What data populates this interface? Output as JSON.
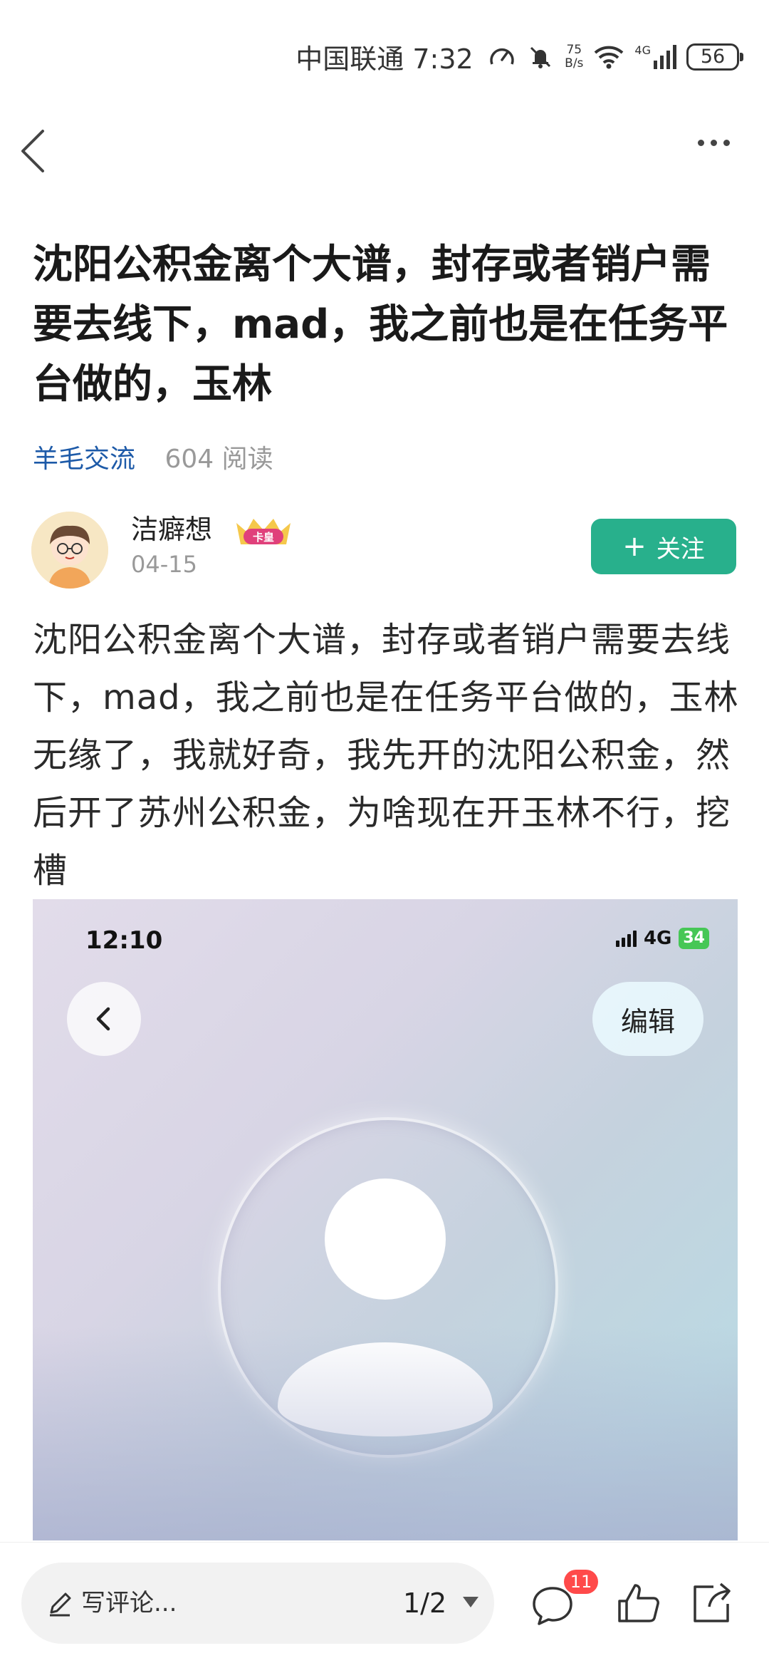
{
  "status_bar": {
    "carrier_time": "中国联通 7:32",
    "net_speed_value": "75",
    "net_speed_unit": "B/s",
    "network": "4G",
    "battery": "56"
  },
  "post": {
    "title": "沈阳公积金离个大谱，封存或者销户需要去线下，mad，我之前也是在任务平台做的，玉林",
    "category": "羊毛交流",
    "reads": "604 阅读",
    "author": {
      "name": "洁癖想",
      "badge": "卡皇",
      "date": "04-15"
    },
    "follow_label": "关注",
    "body": "沈阳公积金离个大谱，封存或者销户需要去线下，mad，我之前也是在任务平台做的，玉林无缘了，我就好奇，我先开的沈阳公积金，然后开了苏州公积金，为啥现在开玉林不行，挖槽"
  },
  "embedded_screenshot": {
    "time": "12:10",
    "network": "4G",
    "battery": "34",
    "edit_label": "编辑"
  },
  "bottom_bar": {
    "comment_placeholder": "写评论...",
    "page_indicator": "1/2",
    "comment_count": "11"
  },
  "icons": {
    "back": "back-icon",
    "more": "more-icon",
    "pen": "pen-icon",
    "comment": "comment-icon",
    "like": "like-icon",
    "share": "share-icon"
  }
}
